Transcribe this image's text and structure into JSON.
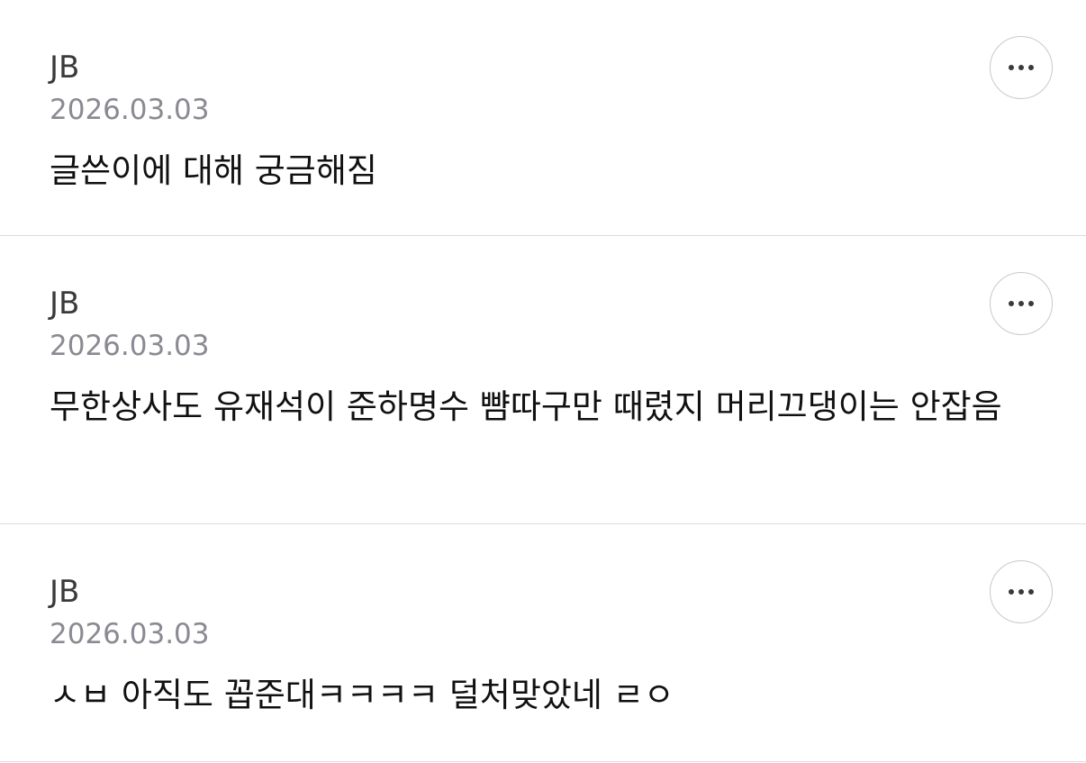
{
  "comments": [
    {
      "author": "JB",
      "date": "2026.03.03",
      "text": "글쓴이에 대해 궁금해짐",
      "menu_icon": "more-horizontal-icon"
    },
    {
      "author": "JB",
      "date": "2026.03.03",
      "text": "무한상사도 유재석이 준하명수 뺨따구만 때렸지 머리끄댕이는 안잡음",
      "menu_icon": "more-horizontal-icon"
    },
    {
      "author": "JB",
      "date": "2026.03.03",
      "text": "ㅅㅂ 아직도 꼽준대ㅋㅋㅋㅋ 덜처맞았네 ㄹㅇ",
      "menu_icon": "more-horizontal-icon"
    }
  ],
  "colors": {
    "author": "#3a3a3c",
    "date": "#8a8a92",
    "text": "#111111",
    "divider": "#dcdce0",
    "button_border": "#c9c9cd",
    "icon": "#3a3a3c"
  }
}
